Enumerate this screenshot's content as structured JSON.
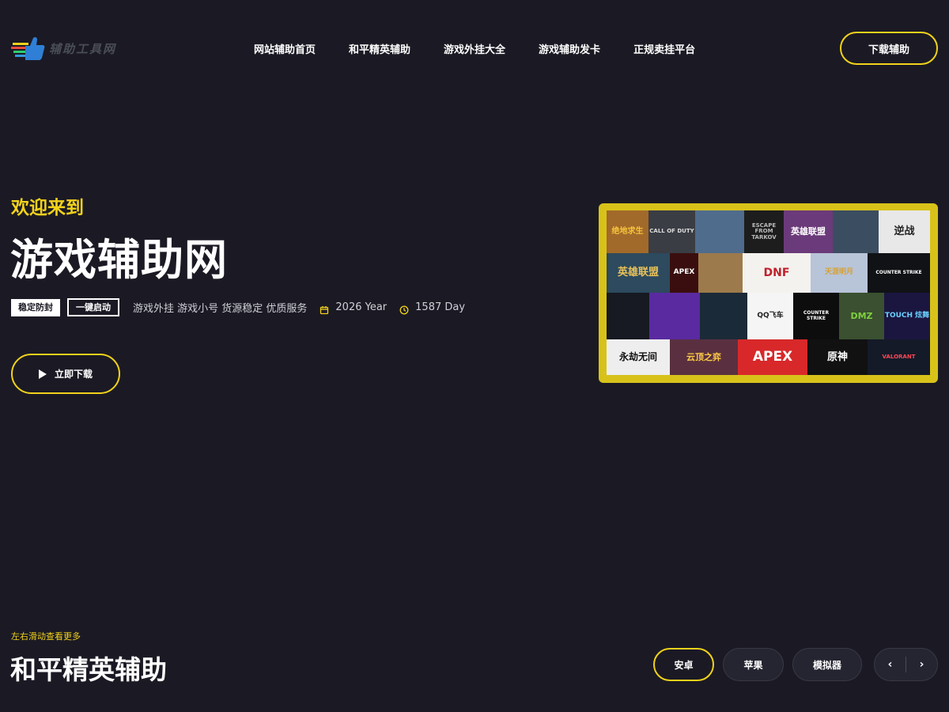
{
  "header": {
    "logo_text": "辅助工具网",
    "nav": [
      "网站辅助首页",
      "和平精英辅助",
      "游戏外挂大全",
      "游戏辅助发卡",
      "正规卖挂平台"
    ],
    "download_label": "下载辅助"
  },
  "hero": {
    "welcome": "欢迎来到",
    "title": "游戏辅助网",
    "tag_stable": "稳定防封",
    "tag_one_click": "一键启动",
    "description": "游戏外挂 游戏小号 货源稳定 优质服务",
    "year": "2026 Year",
    "days": "1587 Day",
    "play_label": "立即下载"
  },
  "mosaic_tiles": [
    "绝地求生",
    "CALL OF DUTY",
    "",
    "ESCAPE FROM TARKOV",
    "英雄联盟",
    "",
    "逆战",
    "英雄联盟",
    "APEX",
    "",
    "DNF",
    "天涯明月",
    "COUNTER STRIKE",
    "",
    "",
    "",
    "QQ飞车",
    "COUNTER STRIKE",
    "DMZ",
    "TOUCH 炫舞",
    "永劫无间",
    "云顶之弈",
    "APEX",
    "原神",
    "VALORANT"
  ],
  "section": {
    "hint": "左右滑动查看更多",
    "title": "和平精英辅助",
    "filters": [
      "安卓",
      "苹果",
      "模拟器"
    ],
    "prev": "‹",
    "next": "›"
  },
  "colors": {
    "background": "#1b1a24",
    "accent": "#f2d21b",
    "panel": "#252431"
  }
}
